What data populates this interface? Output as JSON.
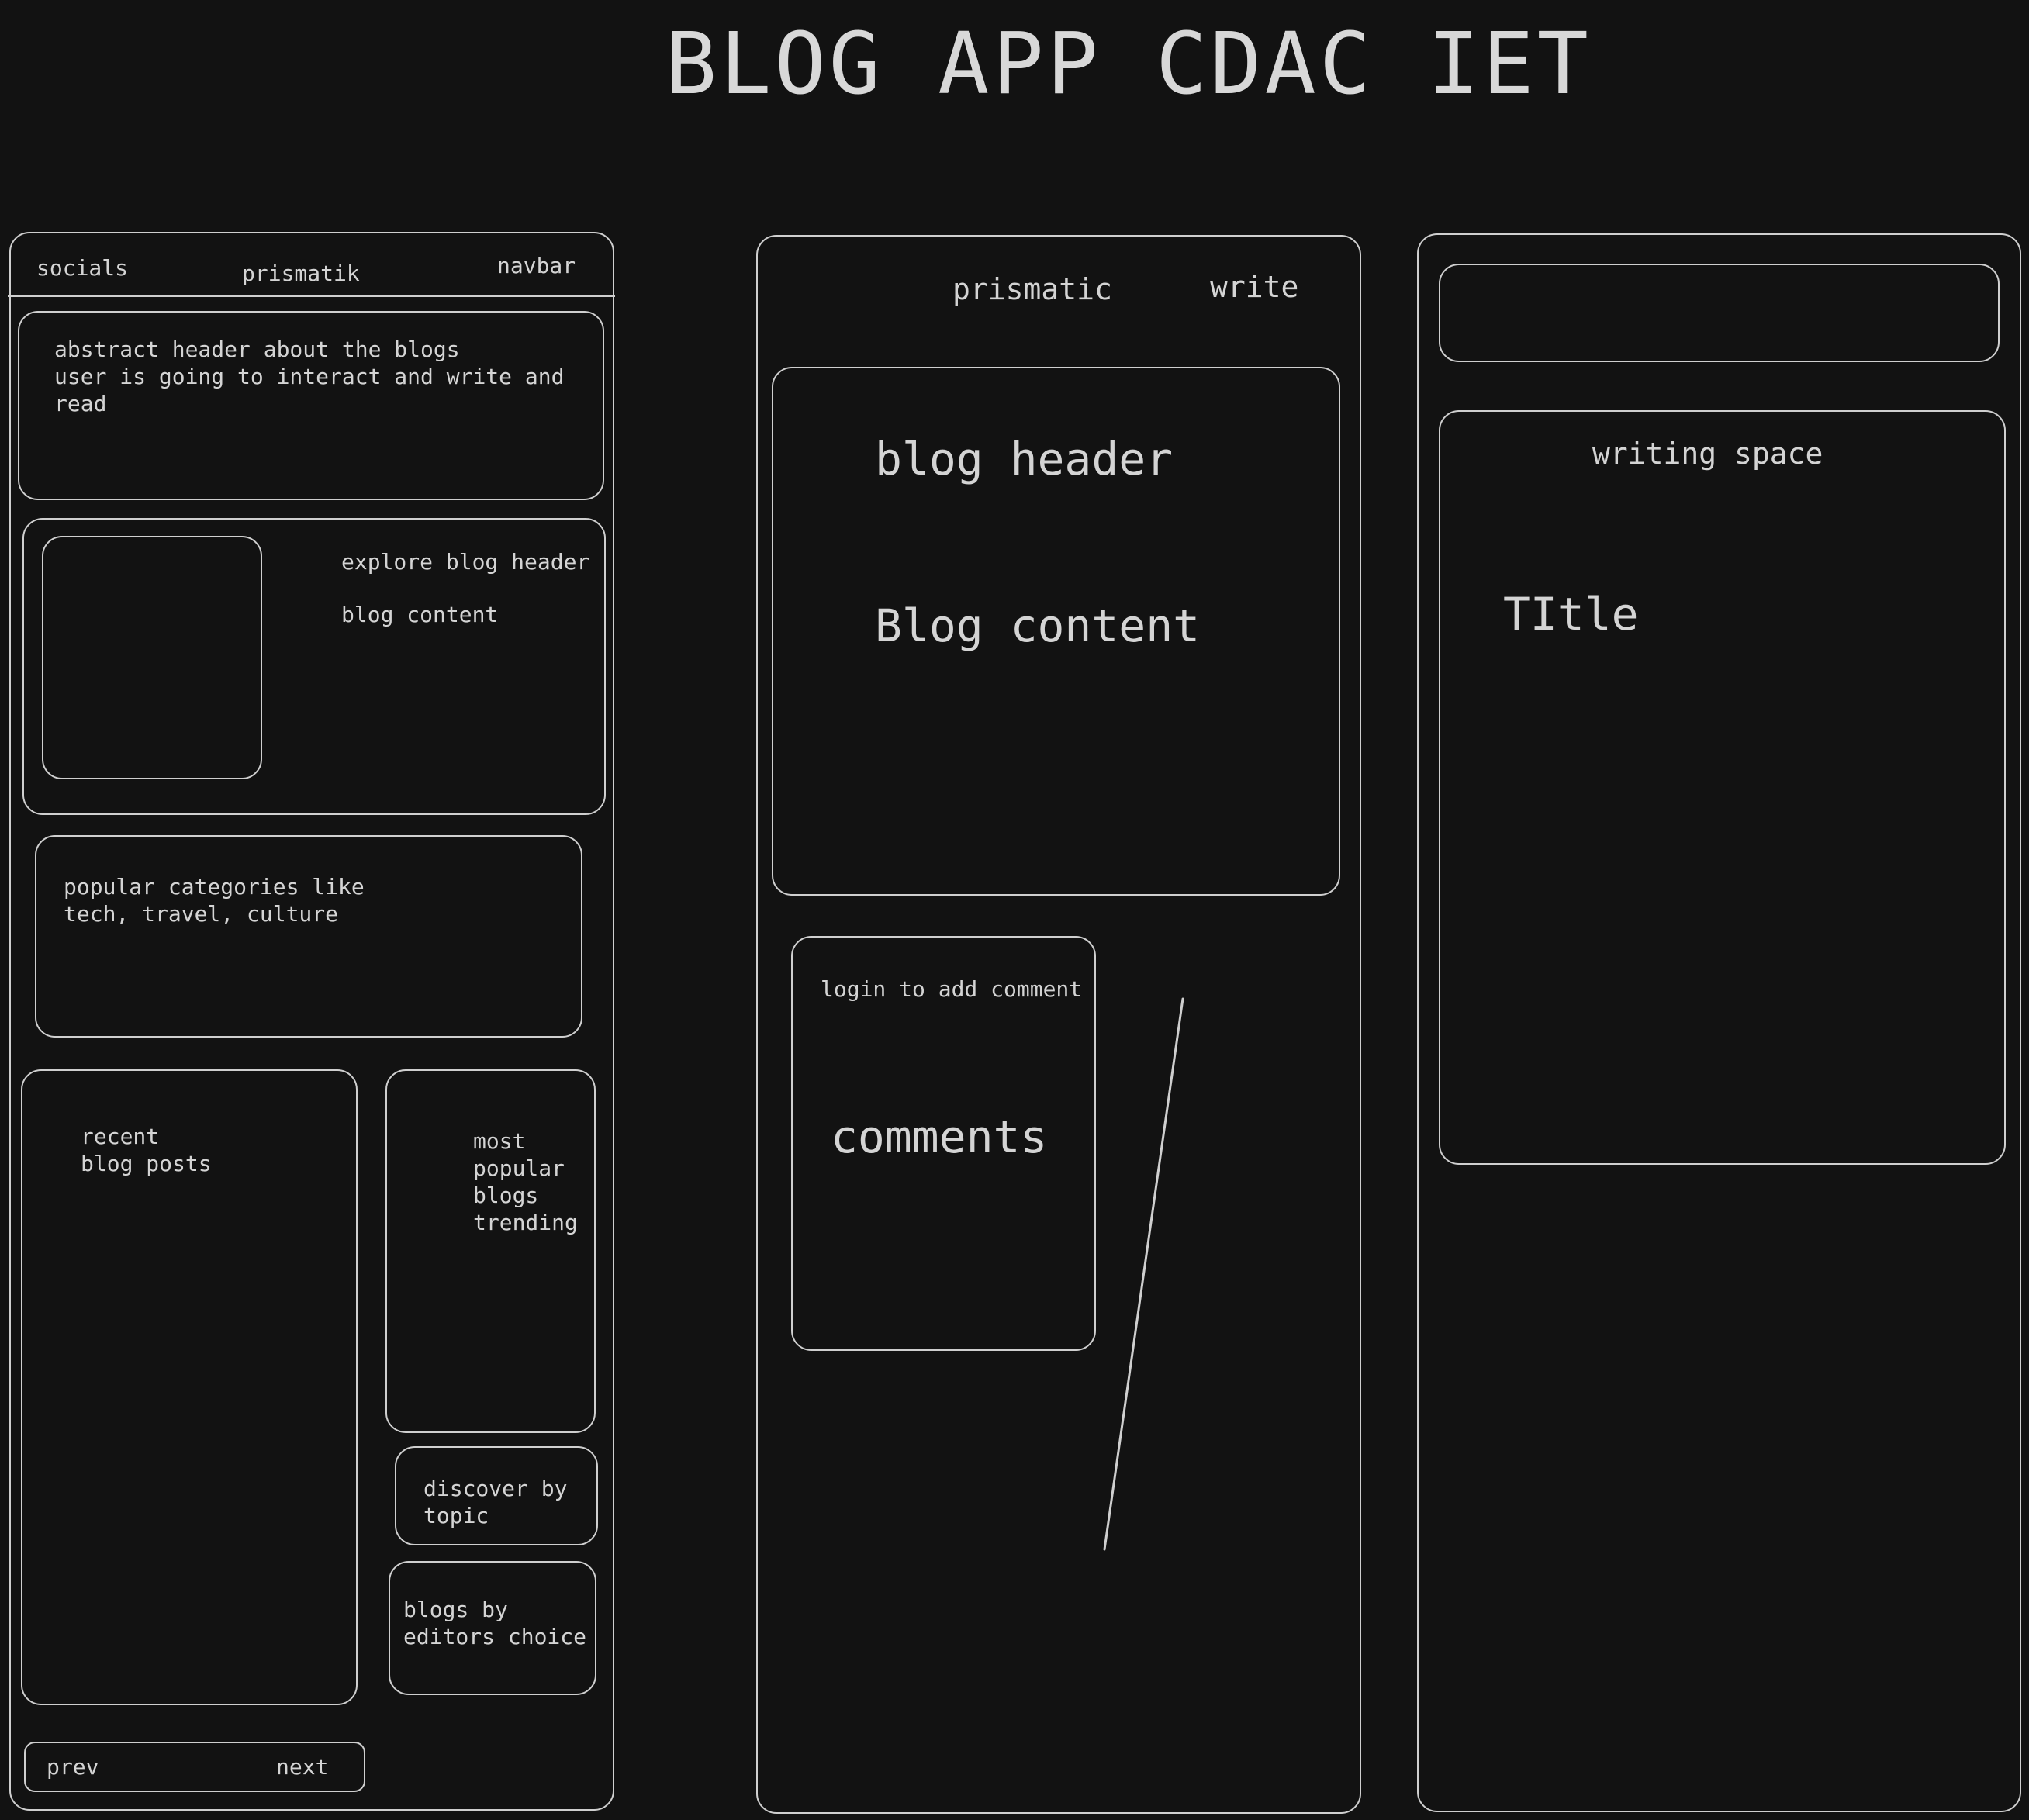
{
  "title": "BLOG APP CDAC IET",
  "home_wireframe": {
    "navbar": {
      "socials": "socials",
      "brand": "prismatik",
      "navbar": "navbar"
    },
    "abstract_header": "abstract header about the blogs\nuser is going to interact and write and\nread",
    "explore": {
      "header": "explore blog header",
      "content": "blog content"
    },
    "popular_categories": "popular categories like\ntech, travel, culture",
    "recent_posts": "recent\nblog posts",
    "most_popular": "most\npopular\nblogs\ntrending",
    "discover_by_topic": "discover by\ntopic",
    "editors_choice": "blogs by\neditors choice",
    "pagination": {
      "prev": "prev",
      "next": "next"
    }
  },
  "blog_wireframe": {
    "brand": "prismatic",
    "write": "write",
    "blog_header": "blog header",
    "blog_content": "Blog content",
    "login_prompt": "login to add comment",
    "comments": "comments"
  },
  "write_wireframe": {
    "writing_space": "writing space",
    "title_label": "TItle"
  }
}
